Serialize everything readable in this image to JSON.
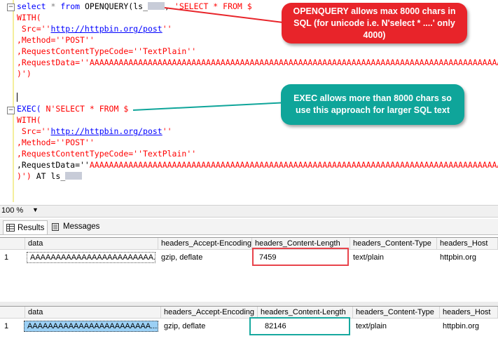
{
  "editor": {
    "lines1": {
      "l1_kw1": "select",
      "l1_op": "*",
      "l1_kw2": "from",
      "l1_func": "OPENQUERY(",
      "l1_ls": "ls_",
      "l1_sep": ",",
      "l1_str": "'SELECT * FROM $",
      "l2": "WITH(",
      "l3_a": " Src=''",
      "l3_url": "http://httpbin.org/post",
      "l3_b": "''",
      "l4": ",Method=''POST''",
      "l5": ",RequestContentTypeCode=''TextPlain''",
      "l6": ",RequestData=''AAAAAAAAAAAAAAAAAAAAAAAAAAAAAAAAAAAAAAAAAAAAAAAAAAAAAAAAAAAAAAAAAAAAAAAAAAAAAAAAAAAAAAAAAAAAAAAAAAAAAAAAAAA",
      "l7": ")')"
    },
    "lines2": {
      "l1_kw": "EXEC(",
      "l1_str": " N'SELECT * FROM $",
      "l2": "WITH(",
      "l3_a": " Src=''",
      "l3_url": "http://httpbin.org/post",
      "l3_b": "''",
      "l4": ",Method=''POST''",
      "l5": ",RequestContentTypeCode=''TextPlain''",
      "l6_a": ",RequestData=''",
      "l6_b": "AAAAAAAAAAAAAAAAAAAAAAAAAAAAAAAAAAAAAAAAAAAAAAAAAAAAAAAAAAAAAAAAAAAAAAAAAAAAAAAAAAAAAAAAAAAAAAAAAAAAAAAAAA",
      "l7_a": ")')",
      "l7_kw": " AT ls_"
    }
  },
  "callouts": {
    "red": "OPENQUERY allows max 8000 chars in SQL (for unicode i.e. N'select * ....'  only 4000)",
    "teal": "EXEC allows more than 8000 chars so use this approach for larger SQL text"
  },
  "status": {
    "zoom": "100 %"
  },
  "tabs": {
    "results": "Results",
    "messages": "Messages"
  },
  "grid1": {
    "headers": [
      "data",
      "headers_Accept-Encoding",
      "headers_Content-Length",
      "headers_Content-Type",
      "headers_Host"
    ],
    "rows": [
      {
        "num": "1",
        "data": "AAAAAAAAAAAAAAAAAAAAAAAA...",
        "accept": "gzip, deflate",
        "length": "7459",
        "type": "text/plain",
        "host": "httpbin.org"
      }
    ]
  },
  "grid2": {
    "headers": [
      "data",
      "headers_Accept-Encoding",
      "headers_Content-Length",
      "headers_Content-Type",
      "headers_Host"
    ],
    "rows": [
      {
        "num": "1",
        "data": "AAAAAAAAAAAAAAAAAAAAAAAA...",
        "accept": "gzip, deflate",
        "length": "82146",
        "type": "text/plain",
        "host": "httpbin.org"
      }
    ]
  },
  "colors": {
    "callout_red": "#e8242a",
    "callout_teal": "#0fa59a",
    "highlight_red": "#e8434b",
    "highlight_teal": "#17a99f",
    "selection": "#9bd0f5"
  }
}
